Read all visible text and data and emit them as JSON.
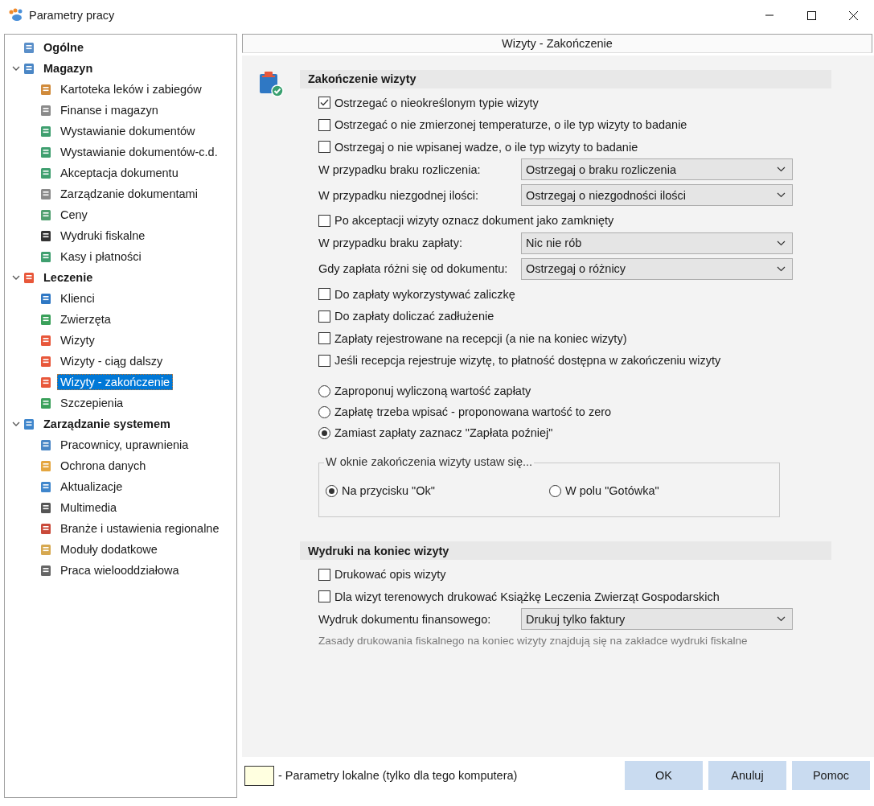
{
  "window": {
    "title": "Parametry pracy"
  },
  "sidebar": {
    "items": [
      {
        "label": "Ogólne",
        "selected": false
      },
      {
        "label": "Magazyn",
        "selected": false,
        "expanded": true,
        "children": [
          {
            "label": "Kartoteka leków i zabiegów",
            "selected": false
          },
          {
            "label": "Finanse i magazyn",
            "selected": false
          },
          {
            "label": "Wystawianie dokumentów",
            "selected": false
          },
          {
            "label": "Wystawianie dokumentów-c.d.",
            "selected": false
          },
          {
            "label": "Akceptacja dokumentu",
            "selected": false
          },
          {
            "label": "Zarządzanie dokumentami",
            "selected": false
          },
          {
            "label": "Ceny",
            "selected": false
          },
          {
            "label": "Wydruki fiskalne",
            "selected": false
          },
          {
            "label": "Kasy i płatności",
            "selected": false
          }
        ]
      },
      {
        "label": "Leczenie",
        "selected": false,
        "expanded": true,
        "children": [
          {
            "label": "Klienci",
            "selected": false
          },
          {
            "label": "Zwierzęta",
            "selected": false
          },
          {
            "label": "Wizyty",
            "selected": false
          },
          {
            "label": "Wizyty - ciąg dalszy",
            "selected": false
          },
          {
            "label": "Wizyty - zakończenie",
            "selected": true
          },
          {
            "label": "Szczepienia",
            "selected": false
          }
        ]
      },
      {
        "label": "Zarządzanie systemem",
        "selected": false,
        "expanded": true,
        "children": [
          {
            "label": "Pracownicy, uprawnienia",
            "selected": false
          },
          {
            "label": "Ochrona danych",
            "selected": false
          },
          {
            "label": "Aktualizacje",
            "selected": false
          },
          {
            "label": "Multimedia",
            "selected": false
          },
          {
            "label": "Branże i ustawienia regionalne",
            "selected": false
          },
          {
            "label": "Moduły dodatkowe",
            "selected": false
          },
          {
            "label": "Praca wielooddziałowa",
            "selected": false
          }
        ]
      }
    ]
  },
  "page": {
    "title": "Wizyty -  Zakończenie",
    "sections": [
      {
        "title": "Zakończenie wizyty",
        "items": [
          {
            "kind": "checkbox",
            "label": "Ostrzegać o nieokreślonym typie wizyty",
            "checked": true
          },
          {
            "kind": "checkbox",
            "label": "Ostrzegać o nie zmierzonej temperaturze, o ile typ wizyty to badanie",
            "checked": false
          },
          {
            "kind": "checkbox",
            "label": "Ostrzegaj o nie wpisanej wadze, o ile typ wizyty to badanie",
            "checked": false
          },
          {
            "kind": "select",
            "label": "W przypadku braku rozliczenia:",
            "value": "Ostrzegaj o braku rozliczenia"
          },
          {
            "kind": "select",
            "label": "W przypadku niezgodnej ilości:",
            "value": "Ostrzegaj o niezgodności ilości"
          },
          {
            "kind": "checkbox",
            "label": "Po akceptacji wizyty oznacz dokument jako zamknięty",
            "checked": false
          },
          {
            "kind": "select",
            "label": "W przypadku braku zapłaty:",
            "value": "Nic nie rób"
          },
          {
            "kind": "select",
            "label": "Gdy zapłata różni się od dokumentu:",
            "value": "Ostrzegaj o różnicy"
          },
          {
            "kind": "checkbox",
            "label": "Do zapłaty wykorzystywać zaliczkę",
            "checked": false
          },
          {
            "kind": "checkbox",
            "label": "Do zapłaty doliczać zadłużenie",
            "checked": false
          },
          {
            "kind": "checkbox",
            "label": "Zapłaty rejestrowane na recepcji (a nie na koniec wizyty)",
            "checked": false
          },
          {
            "kind": "checkbox",
            "label": "Jeśli recepcja rejestruje wizytę, to płatność dostępna w zakończeniu wizyty",
            "checked": false
          },
          {
            "kind": "radio",
            "label": "Zaproponuj wyliczoną wartość zapłaty",
            "selected": false
          },
          {
            "kind": "radio",
            "label": "Zapłatę trzeba wpisać - proponowana wartość to zero",
            "selected": false
          },
          {
            "kind": "radio",
            "label": "Zamiast zapłaty zaznacz \"Zapłata poźniej\"",
            "selected": true
          },
          {
            "kind": "group",
            "label": "W oknie zakończenia wizyty ustaw się...",
            "options": [
              {
                "label": "Na przycisku \"Ok\"",
                "selected": true
              },
              {
                "label": "W polu \"Gotówka\"",
                "selected": false
              }
            ]
          }
        ]
      },
      {
        "title": "Wydruki na koniec wizyty",
        "items": [
          {
            "kind": "checkbox",
            "label": "Drukować opis wizyty",
            "checked": false
          },
          {
            "kind": "checkbox",
            "label": "Dla wizyt terenowych drukować Książkę Leczenia Zwierząt Gospodarskich",
            "checked": false
          },
          {
            "kind": "select",
            "label": "Wydruk dokumentu finansowego:",
            "value": "Drukuj tylko faktury"
          },
          {
            "kind": "note",
            "label": "Zasady drukowania fiskalnego na koniec wizyty znajdują się na zakładce wydruki fiskalne"
          }
        ]
      }
    ]
  },
  "footer": {
    "legend": "- Parametry lokalne (tylko dla tego komputera)",
    "buttons": [
      "OK",
      "Anuluj",
      "Pomoc"
    ]
  }
}
